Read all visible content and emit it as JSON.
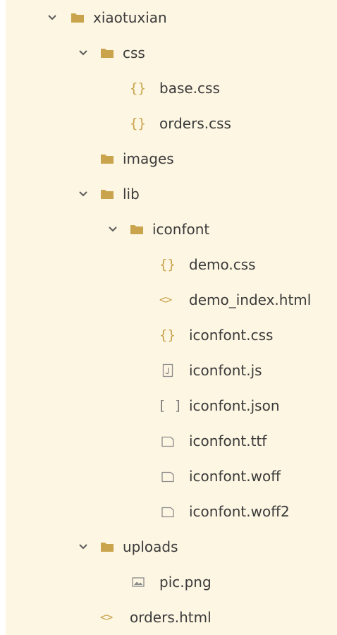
{
  "colors": {
    "background": "#fdf6e3",
    "folder": "#c9a44c",
    "code_icon": "#c9a44c",
    "file_icon": "#8a8a8a",
    "text": "#3a3a3a"
  },
  "tree": [
    {
      "label": "xiaotuxian",
      "type": "folder",
      "expanded": true,
      "icon": "folder-icon"
    },
    {
      "label": "css",
      "type": "folder",
      "expanded": true,
      "icon": "folder-icon"
    },
    {
      "label": "base.css",
      "type": "file",
      "icon": "braces-icon",
      "icon_glyph": "{}"
    },
    {
      "label": "orders.css",
      "type": "file",
      "icon": "braces-icon",
      "icon_glyph": "{}"
    },
    {
      "label": "images",
      "type": "folder",
      "expanded": false,
      "icon": "folder-icon"
    },
    {
      "label": "lib",
      "type": "folder",
      "expanded": true,
      "icon": "folder-icon"
    },
    {
      "label": "iconfont",
      "type": "folder",
      "expanded": true,
      "icon": "folder-icon"
    },
    {
      "label": "demo.css",
      "type": "file",
      "icon": "braces-icon",
      "icon_glyph": "{}"
    },
    {
      "label": "demo_index.html",
      "type": "file",
      "icon": "code-icon",
      "icon_glyph": "<>"
    },
    {
      "label": "iconfont.css",
      "type": "file",
      "icon": "braces-icon",
      "icon_glyph": "{}"
    },
    {
      "label": "iconfont.js",
      "type": "file",
      "icon": "js-file-icon"
    },
    {
      "label": "iconfont.json",
      "type": "file",
      "icon": "brackets-icon",
      "icon_glyph": "[ ]"
    },
    {
      "label": "iconfont.ttf",
      "type": "file",
      "icon": "file-icon"
    },
    {
      "label": "iconfont.woff",
      "type": "file",
      "icon": "file-icon"
    },
    {
      "label": "iconfont.woff2",
      "type": "file",
      "icon": "file-icon"
    },
    {
      "label": "uploads",
      "type": "folder",
      "expanded": true,
      "icon": "folder-icon"
    },
    {
      "label": "pic.png",
      "type": "file",
      "icon": "image-icon"
    },
    {
      "label": "orders.html",
      "type": "file",
      "icon": "code-icon",
      "icon_glyph": "<>"
    }
  ]
}
